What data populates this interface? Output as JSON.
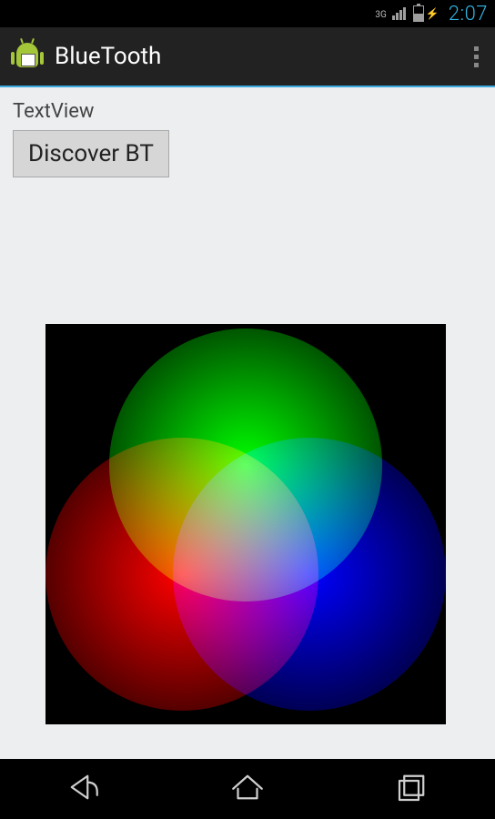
{
  "status_bar": {
    "network_label": "3G",
    "clock": "2:07"
  },
  "action_bar": {
    "title": "BlueTooth"
  },
  "content": {
    "textview_label": "TextView",
    "discover_button_label": "Discover BT"
  }
}
